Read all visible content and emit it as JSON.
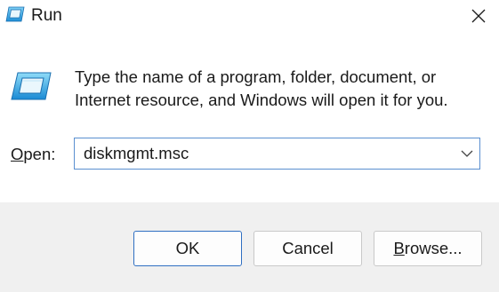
{
  "window": {
    "title": "Run",
    "icons": {
      "app": "run-icon",
      "close": "close-icon",
      "dropdown": "chevron-down-icon"
    }
  },
  "content": {
    "description_line1": "Type the name of a program, folder, document, or",
    "description_line2": "Internet resource, and Windows will open it for you.",
    "open_label_prefix": "O",
    "open_label_rest": "pen:",
    "open_value": "diskmgmt.msc"
  },
  "buttons": {
    "ok": "OK",
    "cancel": "Cancel",
    "browse_prefix": "B",
    "browse_rest": "rowse..."
  },
  "colors": {
    "accent": "#2f6fc2",
    "footer_bg": "#f0f0f0",
    "icon_blue": "#2f9fe0"
  }
}
